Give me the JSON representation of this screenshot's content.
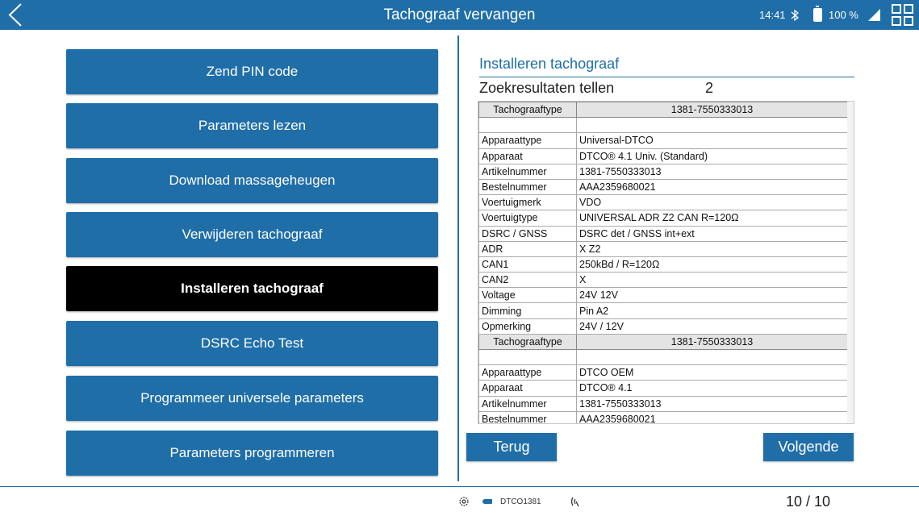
{
  "header": {
    "title": "Tachograaf vervangen",
    "time": "14:41",
    "battery": "100 %"
  },
  "menu": [
    {
      "label": "Zend PIN code",
      "active": false
    },
    {
      "label": "Parameters lezen",
      "active": false
    },
    {
      "label": "Download massageheugen",
      "active": false
    },
    {
      "label": "Verwijderen tachograaf",
      "active": false
    },
    {
      "label": "Installeren tachograaf",
      "active": true
    },
    {
      "label": "DSRC Echo Test",
      "active": false
    },
    {
      "label": "Programmeer universele parameters",
      "active": false
    },
    {
      "label": "Parameters programmeren",
      "active": false
    }
  ],
  "panel": {
    "title": "Installeren tachograaf",
    "count_label": "Zoekresultaten tellen",
    "count_value": "2"
  },
  "results": [
    {
      "header_key": "Tachograaftype",
      "header_value": "1381-7550333013",
      "rows": [
        [
          "",
          ""
        ],
        [
          "Apparaattype",
          "Universal-DTCO"
        ],
        [
          "Apparaat",
          "DTCO® 4.1 Univ. (Standard)"
        ],
        [
          "Artikelnummer",
          "1381-7550333013"
        ],
        [
          "Bestelnummer",
          "AAA2359680021"
        ],
        [
          "Voertuigmerk",
          "VDO"
        ],
        [
          "Voertuigtype",
          "UNIVERSAL ADR Z2 CAN R=120Ω"
        ],
        [
          "DSRC / GNSS",
          "DSRC det / GNSS int+ext"
        ],
        [
          "ADR",
          "X Z2"
        ],
        [
          "CAN1",
          "250kBd / R=120Ω"
        ],
        [
          "CAN2",
          "X"
        ],
        [
          "Voltage",
          "24V 12V"
        ],
        [
          "Dimming",
          "Pin A2"
        ],
        [
          "Opmerking",
          "24V / 12V"
        ]
      ]
    },
    {
      "header_key": "Tachograaftype",
      "header_value": "1381-7550333013",
      "rows": [
        [
          "",
          ""
        ],
        [
          "Apparaattype",
          "DTCO OEM"
        ],
        [
          "Apparaat",
          "DTCO® 4.1"
        ],
        [
          "Artikelnummer",
          "1381-7550333013"
        ],
        [
          "Bestelnummer",
          "AAA2359680021"
        ]
      ]
    }
  ],
  "buttons": {
    "back": "Terug",
    "next": "Volgende"
  },
  "footer": {
    "device": "DTCO1381",
    "page": "10 / 10"
  },
  "icons": {
    "back": "chevron-left-icon",
    "bluetooth": "bluetooth-icon",
    "battery": "battery-icon",
    "signal": "signal-icon",
    "grid": "grid-icon",
    "settings": "gear-icon",
    "vehicle": "vehicle-icon",
    "connection": "wireless-icon"
  },
  "colors": {
    "accent": "#1f6ea8",
    "active": "#000000"
  }
}
